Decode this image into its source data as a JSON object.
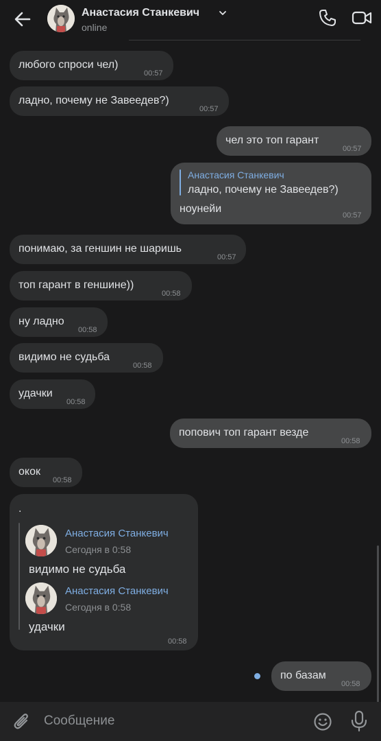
{
  "header": {
    "contact_name": "Анастасия Станкевич",
    "status": "online"
  },
  "messages": [
    {
      "text": "любого спроси чел)",
      "time": "00:57",
      "dir": "in"
    },
    {
      "text": "ладно, почему не Завеедев?)",
      "time": "00:57",
      "dir": "in"
    },
    {
      "text": "чел это топ гарант",
      "time": "00:57",
      "dir": "out"
    },
    {
      "reply_to_name": "Анастасия Станкевич",
      "reply_to_text": "ладно, почему не Завеедев?)",
      "text": "ноунейи",
      "time": "00:57",
      "dir": "out"
    },
    {
      "text": "понимаю, за геншин не шаришь",
      "time": "00:57",
      "dir": "in"
    },
    {
      "text": "топ гарант в геншине))",
      "time": "00:58",
      "dir": "in"
    },
    {
      "text": "ну ладно",
      "time": "00:58",
      "dir": "in"
    },
    {
      "text": "видимо не судьба",
      "time": "00:58",
      "dir": "in"
    },
    {
      "text": "удачки",
      "time": "00:58",
      "dir": "in"
    },
    {
      "text": "попович топ гарант везде",
      "time": "00:58",
      "dir": "out"
    },
    {
      "text": "окок",
      "time": "00:58",
      "dir": "in"
    },
    {
      "text": ".",
      "time": "00:58",
      "dir": "in",
      "forwarded": [
        {
          "name": "Анастасия Станкевич",
          "date": "Сегодня в 0:58",
          "text": "видимо не судьба"
        },
        {
          "name": "Анастасия Станкевич",
          "date": "Сегодня в 0:58",
          "text": "удачки"
        }
      ]
    },
    {
      "text": "по базам",
      "time": "00:58",
      "dir": "out",
      "unread": true
    }
  ],
  "composer": {
    "placeholder": "Сообщение"
  },
  "colors": {
    "background": "#19191a",
    "incoming_bubble": "#2c2d2e",
    "outgoing_bubble": "#454647",
    "accent": "#7faee3"
  },
  "icons": [
    "back-arrow-icon",
    "chevron-down-icon",
    "phone-icon",
    "video-camera-icon",
    "paperclip-icon",
    "emoji-icon",
    "microphone-icon"
  ]
}
